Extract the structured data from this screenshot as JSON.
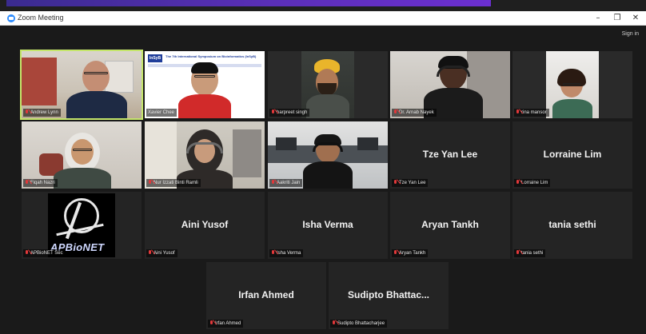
{
  "window": {
    "title": "Zoom Meeting",
    "controls": {
      "minimize": "–",
      "maximize": "❐",
      "close": "✕"
    }
  },
  "header": {
    "sign_in": "Sign in"
  },
  "participants": [
    {
      "id": "andrew",
      "label": "Andrew Lynn",
      "video": true,
      "muted": true,
      "active_speaker": true
    },
    {
      "id": "xavier",
      "label": "Xavier Chee",
      "video": true,
      "muted": false,
      "slide_logo": "InSyB",
      "slide_header": "The 7th International Symposium on Bioinformatics (InSyB)",
      "slide_sub": "Integrative Bioinformatics and Systems Biology: From Molecules to Ecosystem"
    },
    {
      "id": "harpreet",
      "label": "harpreet singh",
      "video": true,
      "muted": true
    },
    {
      "id": "arnab",
      "label": "Dr. Arnab Nayek",
      "video": true,
      "muted": true
    },
    {
      "id": "rina",
      "label": "rina mansor",
      "video": true,
      "muted": true
    },
    {
      "id": "fiqah",
      "label": "Fiqah Nazri",
      "video": true,
      "muted": true
    },
    {
      "id": "nur",
      "label": "Nur Izzati Binti Ramli",
      "video": true,
      "muted": true
    },
    {
      "id": "aakriti",
      "label": "Aakriti Jain",
      "video": true,
      "muted": true
    },
    {
      "id": "tze",
      "label": "Tze Yan Lee",
      "display_name": "Tze Yan Lee",
      "video": false,
      "muted": true
    },
    {
      "id": "lorraine",
      "label": "Lorraine Lim",
      "display_name": "Lorraine Lim",
      "video": false,
      "muted": true
    },
    {
      "id": "apbionet",
      "label": "APBioNET Sec",
      "logo_text": "APBioNET",
      "video": true,
      "muted": true
    },
    {
      "id": "aini",
      "label": "Aini Yusof",
      "display_name": "Aini Yusof",
      "video": false,
      "muted": true
    },
    {
      "id": "isha",
      "label": "Isha Verma",
      "display_name": "Isha Verma",
      "video": false,
      "muted": true
    },
    {
      "id": "aryan",
      "label": "Aryan Tankh",
      "display_name": "Aryan Tankh",
      "video": false,
      "muted": true
    },
    {
      "id": "tania",
      "label": "tania sethi",
      "display_name": "tania sethi",
      "video": false,
      "muted": true
    },
    {
      "id": "irfan",
      "label": "Irfan Ahmed",
      "display_name": "Irfan Ahmed",
      "video": false,
      "muted": true
    },
    {
      "id": "sudipto",
      "label": "Sudipto Bhattacharjee",
      "display_name": "Sudipto  Bhattac...",
      "video": false,
      "muted": true
    }
  ],
  "colors": {
    "background": "#1a1a1a",
    "tile": "#242424",
    "active_speaker_border": "#c5e66b",
    "mute_icon": "#e2383a",
    "share_bar": "#5a2fb8"
  }
}
